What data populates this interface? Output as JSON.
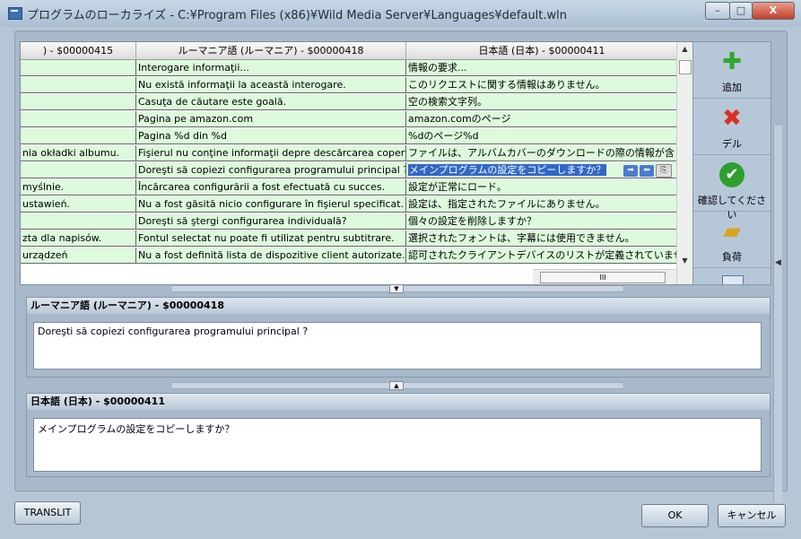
{
  "window": {
    "title": "プログラムのローカライズ - C:¥Program Files (x86)¥Wild Media Server¥Languages¥default.wln",
    "minimize_label": "–",
    "maximize_label": "□",
    "close_label": "X"
  },
  "grid": {
    "columns": [
      ") - $00000415",
      "ルーマニア語 (ルーマニア) - $00000418",
      "日本語 (日本) - $00000411"
    ],
    "rows": [
      {
        "c0": "",
        "c1": "Interogare informaţii...",
        "c2": "情報の要求..."
      },
      {
        "c0": "",
        "c1": "Nu există informaţii la această interogare.",
        "c2": "このリクエストに関する情報はありません。"
      },
      {
        "c0": "",
        "c1": "Casuţa de căutare este goală.",
        "c2": "空の検索文字列。"
      },
      {
        "c0": "",
        "c1": "Pagina pe amazon.com",
        "c2": "amazon.comのページ"
      },
      {
        "c0": "",
        "c1": "Pagina %d din %d",
        "c2": "%dのページ%d"
      },
      {
        "c0": "nia okładki albumu.",
        "c1": "Fişierul nu conţine informaţii depre descărcarea coperţii album",
        "c2": "ファイルは、アルバムカバーのダウンロードの際の情報が含まれて("
      },
      {
        "c0": "",
        "c1": "Doreşti să copiezi configurarea programului principal ?",
        "c2": "メインプログラムの設定をコピーしますか？"
      },
      {
        "c0": "myślnie.",
        "c1": "Încărcarea configurării a fost efectuată cu succes.",
        "c2": "設定が正常にロード。"
      },
      {
        "c0": "ustawień.",
        "c1": "Nu a fost găsită nicio configurare în fişierul specificat.",
        "c2": "設定は、指定されたファイルにありません。"
      },
      {
        "c0": "",
        "c1": "Doreşti să ştergi configurarea individuală?",
        "c2": "個々の設定を削除しますか？"
      },
      {
        "c0": "zta dla napisów.",
        "c1": "Fontul selectat nu poate fi utilizat pentru subtitrare.",
        "c2": "選択されたフォントは、字幕には使用できません。"
      },
      {
        "c0": "urządzeń",
        "c1": "Nu a fost definită lista de dispozitive client autorizate.",
        "c2": "認可されたクライアントデバイスのリストが定義されていません。"
      }
    ],
    "selected_row": 6,
    "hscroll_grip": "III"
  },
  "toolbar": {
    "add_label": "追加",
    "delete_label": "デル",
    "confirm_label": "確認してください",
    "load_label": "負荷",
    "add_color": "#2fa82f",
    "delete_color": "#d83020",
    "confirm_color": "#2e9e2e",
    "load_color": "#d9a520"
  },
  "romanian_section": {
    "header": "ルーマニア語 (ルーマニア) - $00000418",
    "text": "Doreşti să copiezi configurarea programului principal ?"
  },
  "japanese_section": {
    "header": "日本語 (日本) - $00000411",
    "text": "メインプログラムの設定をコピーしますか？"
  },
  "buttons": {
    "translit_label": "TRANSLIT",
    "ok_label": "OK",
    "cancel_label": "キャンセル"
  },
  "colors": {
    "row_background": "#ddfadd",
    "selection": "#3168c8"
  }
}
